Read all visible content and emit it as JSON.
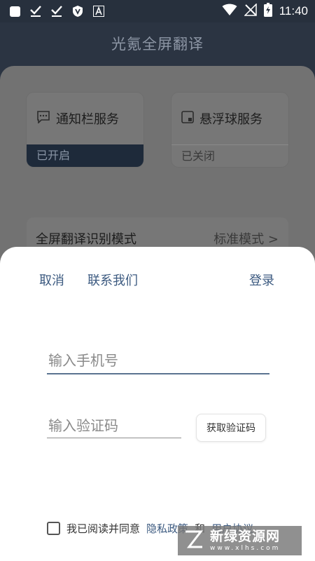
{
  "status_bar": {
    "time": "11:40",
    "left_icons": [
      "notification-square-icon",
      "download-done-icon",
      "download-done-icon",
      "shield-icon",
      "text-a-icon"
    ],
    "right_icons": [
      "wifi-icon",
      "no-signal-icon",
      "battery-charging-icon"
    ]
  },
  "app_title": "光氪全屏翻译",
  "cards": [
    {
      "title": "通知栏服务",
      "status": "已开启",
      "icon": "chat-bubble-icon"
    },
    {
      "title": "悬浮球服务",
      "status": "已关闭",
      "icon": "floating-ball-icon"
    }
  ],
  "mode_row": {
    "label": "全屏翻译识别模式",
    "value": "标准模式 >"
  },
  "sheet": {
    "cancel": "取消",
    "contact": "联系我们",
    "login": "登录",
    "phone_placeholder": "输入手机号",
    "code_placeholder": "输入验证码",
    "get_code": "获取验证码",
    "agree_prefix": "我已阅读并同意",
    "privacy": "隐私政策",
    "and": "和",
    "terms": "用户协议"
  },
  "watermark": {
    "main": "新绿资源网",
    "sub": "www.xlhs.com"
  },
  "colors": {
    "header_bg": "#2b3442",
    "link": "#3c5a80",
    "overlay": "#727272"
  }
}
